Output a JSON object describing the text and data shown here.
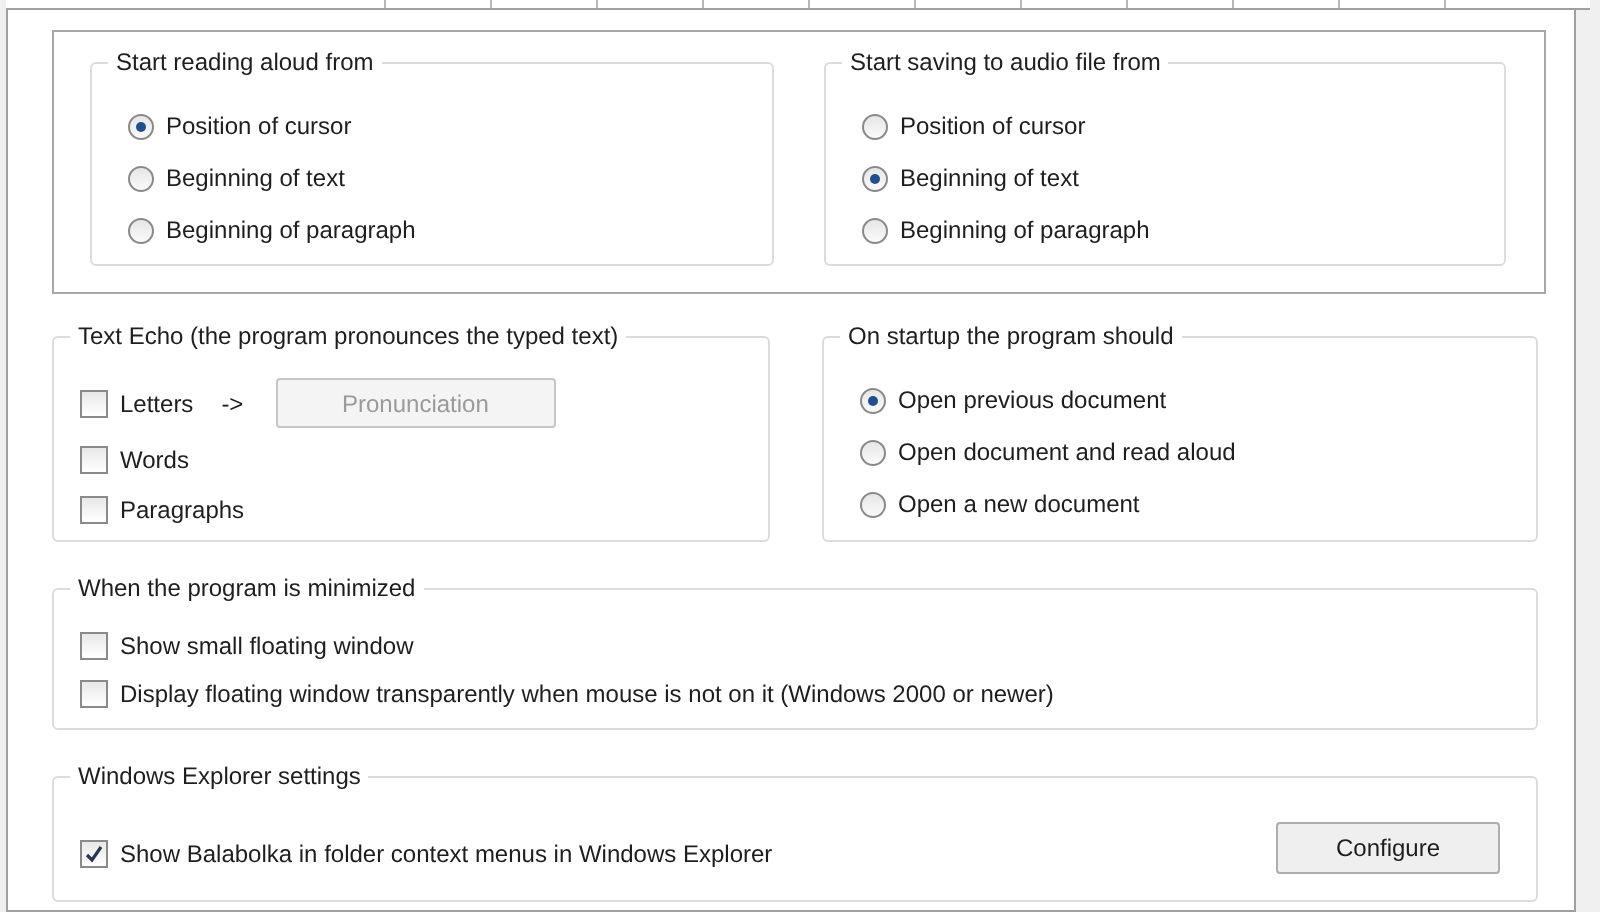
{
  "top_frame": {
    "groups": [
      {
        "title": "Start reading aloud from",
        "options": [
          {
            "label": "Position of cursor",
            "selected": true
          },
          {
            "label": "Beginning of text",
            "selected": false
          },
          {
            "label": "Beginning of paragraph",
            "selected": false
          }
        ]
      },
      {
        "title": "Start saving to audio file from",
        "options": [
          {
            "label": "Position of cursor",
            "selected": false
          },
          {
            "label": "Beginning of text",
            "selected": true
          },
          {
            "label": "Beginning of paragraph",
            "selected": false
          }
        ]
      }
    ]
  },
  "text_echo": {
    "title": "Text Echo (the program pronounces the typed text)",
    "items": [
      {
        "label": "Letters",
        "checked": false
      },
      {
        "label": "Words",
        "checked": false
      },
      {
        "label": "Paragraphs",
        "checked": false
      }
    ],
    "arrow": "->",
    "button": {
      "label": "Pronunciation",
      "disabled": true
    }
  },
  "startup": {
    "title": "On startup the program should",
    "options": [
      {
        "label": "Open previous document",
        "selected": true
      },
      {
        "label": "Open document and read aloud",
        "selected": false
      },
      {
        "label": "Open a new document",
        "selected": false
      }
    ]
  },
  "minimized": {
    "title": "When the program is minimized",
    "items": [
      {
        "label": "Show small floating window",
        "checked": false
      },
      {
        "label": "Display floating window transparently when mouse is not on it (Windows 2000 or newer)",
        "checked": false
      }
    ]
  },
  "explorer": {
    "title": "Windows Explorer settings",
    "items": [
      {
        "label": "Show Balabolka in folder context menus in Windows Explorer",
        "checked": true
      }
    ],
    "button": {
      "label": "Configure",
      "disabled": false
    }
  }
}
